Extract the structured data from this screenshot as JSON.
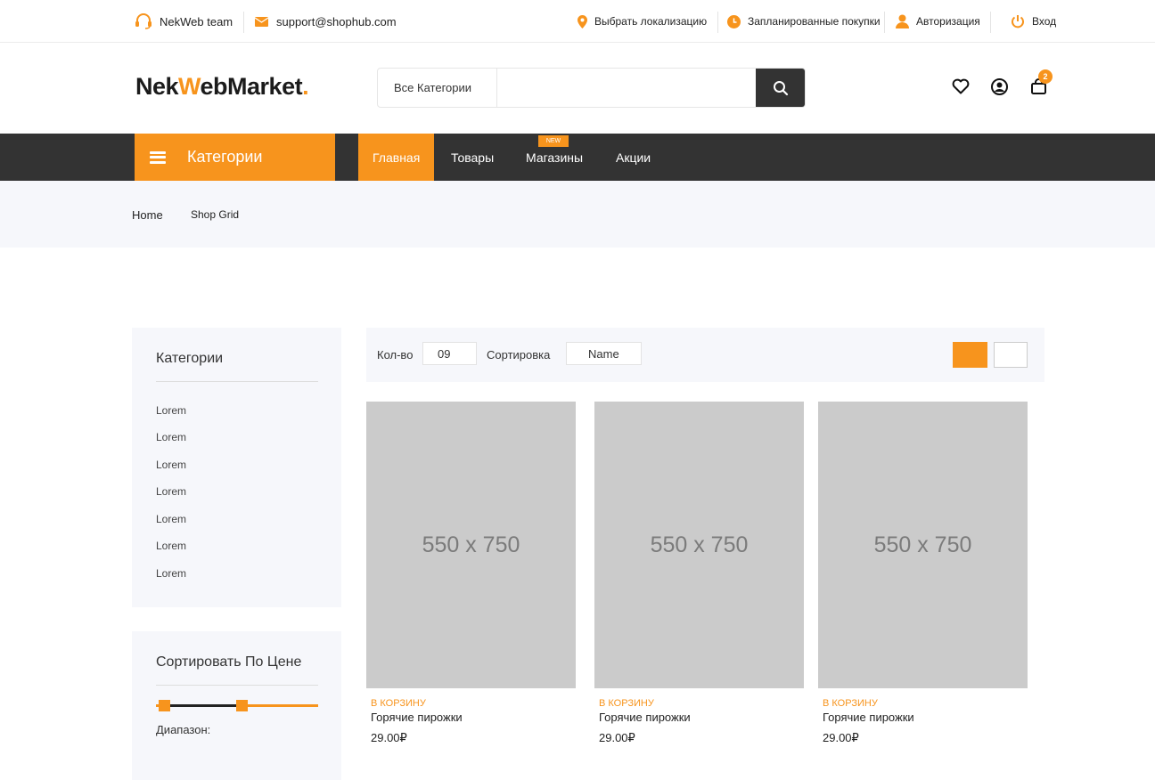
{
  "colors": {
    "accent": "#f7941d",
    "dark": "#333333",
    "light_bg": "#f6f7fb",
    "placeholder": "#cbcbcb"
  },
  "topbar": {
    "team": "NekWeb team",
    "email": "support@shophub.com",
    "location": "Выбрать локализацию",
    "scheduled": "Запланированные покупки",
    "auth": "Авторизация",
    "login": "Вход"
  },
  "header": {
    "logo_part1": "Nek",
    "logo_part2": "W",
    "logo_part3": "ebMarket",
    "logo_dot": ".",
    "search_category": "Все Категории",
    "search_placeholder": "",
    "cart_count": "2"
  },
  "nav": {
    "categories": "Категории",
    "items": [
      {
        "label": "Главная",
        "active": true
      },
      {
        "label": "Товары"
      },
      {
        "label": "Магазины",
        "badge": "NEW"
      },
      {
        "label": "Акции"
      }
    ]
  },
  "breadcrumb": {
    "home": "Home",
    "current": "Shop Grid"
  },
  "sidebar": {
    "categories_title": "Категории",
    "categories": [
      "Lorem",
      "Lorem",
      "Lorem",
      "Lorem",
      "Lorem",
      "Lorem",
      "Lorem"
    ],
    "price_title": "Сортировать По Цене",
    "range_label": "Диапазон:"
  },
  "toolbar": {
    "qty_label": "Кол-во",
    "qty_value": "09",
    "sort_label": "Сортировка",
    "sort_value": "Name"
  },
  "products": [
    {
      "image_text": "550 x 750",
      "cta": "В КОРЗИНУ",
      "name": "Горячие пирожки",
      "price": "29.00₽"
    },
    {
      "image_text": "550 x 750",
      "cta": "В КОРЗИНУ",
      "name": "Горячие пирожки",
      "price": "29.00₽"
    },
    {
      "image_text": "550 x 750",
      "cta": "В КОРЗИНУ",
      "name": "Горячие пирожки",
      "price": "29.00₽"
    }
  ]
}
